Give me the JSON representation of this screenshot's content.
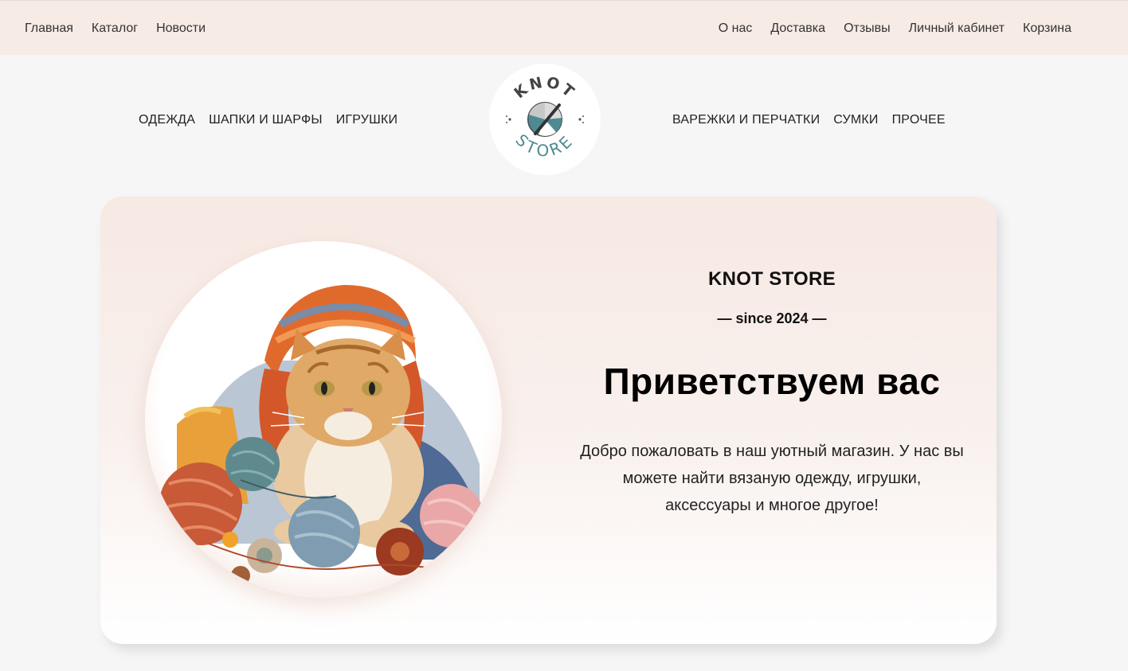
{
  "topnav": {
    "left": [
      {
        "label": "Главная"
      },
      {
        "label": "Каталог"
      },
      {
        "label": "Новости"
      }
    ],
    "right": [
      {
        "label": "О нас"
      },
      {
        "label": "Доставка"
      },
      {
        "label": "Отзывы"
      },
      {
        "label": "Личный кабинет"
      },
      {
        "label": "Корзина"
      }
    ]
  },
  "categories": {
    "left": [
      {
        "label": "ОДЕЖДА"
      },
      {
        "label": "ШАПКИ И ШАРФЫ"
      },
      {
        "label": "ИГРУШКИ"
      }
    ],
    "right": [
      {
        "label": "ВАРЕЖКИ И ПЕРЧАТКИ"
      },
      {
        "label": "СУМКИ"
      },
      {
        "label": "ПРОЧЕЕ"
      }
    ]
  },
  "logo": {
    "top_text": "KNOT",
    "bottom_text": "STORE"
  },
  "hero": {
    "brand": "KNOT STORE",
    "since": "— since 2024 —",
    "headline": "Приветствуем вас",
    "intro": "Добро пожаловать в наш уютный магазин. У нас вы можете найти вязаную одежду, игрушки, аксессуары и многое другое!",
    "image_icon": "cat-with-yarn-illustration"
  },
  "colors": {
    "topbar_bg": "#f7ebe6",
    "page_bg": "#f6f6f6",
    "logo_teal": "#4f8a92",
    "logo_dark": "#444444"
  }
}
